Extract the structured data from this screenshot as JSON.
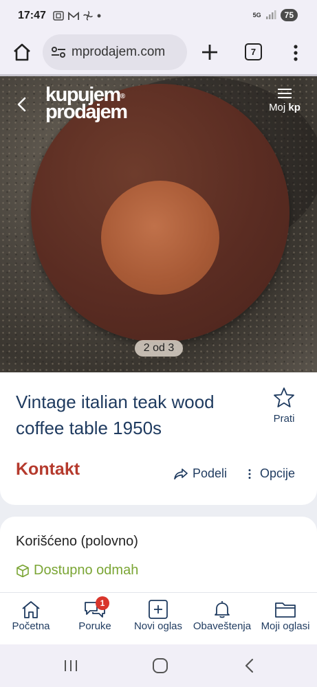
{
  "status_bar": {
    "time": "17:47",
    "network": "5G",
    "battery": "75"
  },
  "browser": {
    "url": "mprodajem.com",
    "tab_count": "7"
  },
  "header": {
    "logo_line1": "kupujem",
    "logo_line2": "prodajem",
    "logo_mark": "®",
    "menu_label": "Moj",
    "menu_label_bold": "kp"
  },
  "gallery": {
    "counter": "2 od 3"
  },
  "listing": {
    "title": "Vintage italian teak wood coffee table 1950s",
    "follow_label": "Prati",
    "contact_label": "Kontakt",
    "share_label": "Podeli",
    "options_label": "Opcije",
    "condition": "Korišćeno (polovno)",
    "availability": "Dostupno odmah"
  },
  "bottom_nav": {
    "items": [
      {
        "label": "Početna",
        "icon": "home-icon"
      },
      {
        "label": "Poruke",
        "icon": "chat-icon",
        "badge": "1"
      },
      {
        "label": "Novi oglas",
        "icon": "add-box-icon"
      },
      {
        "label": "Obaveštenja",
        "icon": "bell-icon"
      },
      {
        "label": "Moji oglasi",
        "icon": "folder-icon"
      }
    ]
  },
  "colors": {
    "brand_blue": "#1e3a5f",
    "contact_red": "#b53a2d",
    "available_green": "#7aa534",
    "badge_red": "#d9352b"
  }
}
